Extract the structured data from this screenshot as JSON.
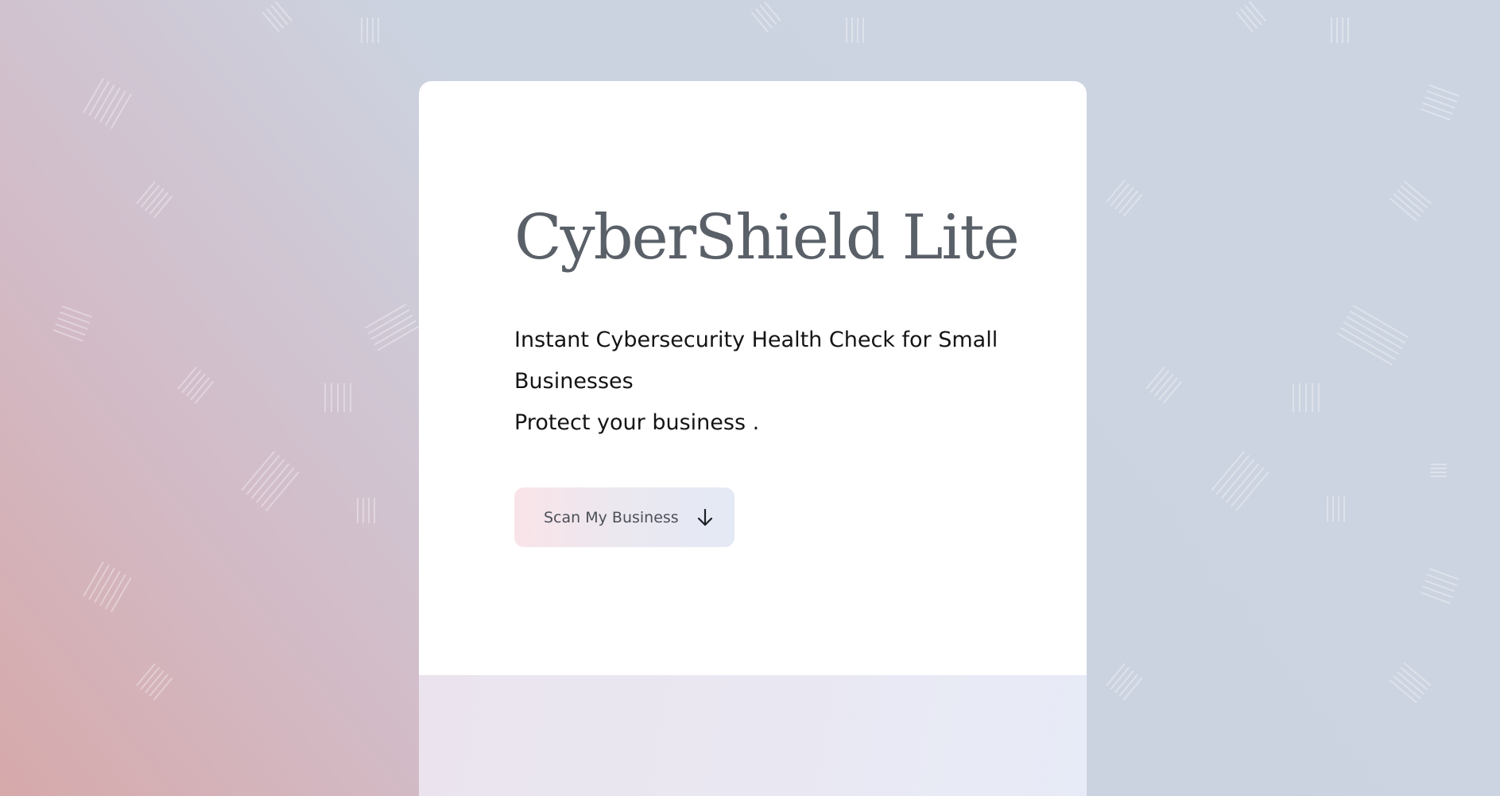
{
  "hero": {
    "title": "CyberShield Lite",
    "tagline": "Instant Cybersecurity Health Check for Small Businesses",
    "subtagline": "Protect your business .",
    "cta_label": "Scan My Business",
    "cta_icon": "arrow-down-icon"
  },
  "colors": {
    "title": "#5a6068",
    "text": "#141414",
    "card": "#ffffff",
    "button_gradient_start": "#f9e4e8",
    "button_gradient_end": "#e3e9f5",
    "background_warm": "#d6a9aa",
    "background_cool": "#ccd4e2"
  }
}
